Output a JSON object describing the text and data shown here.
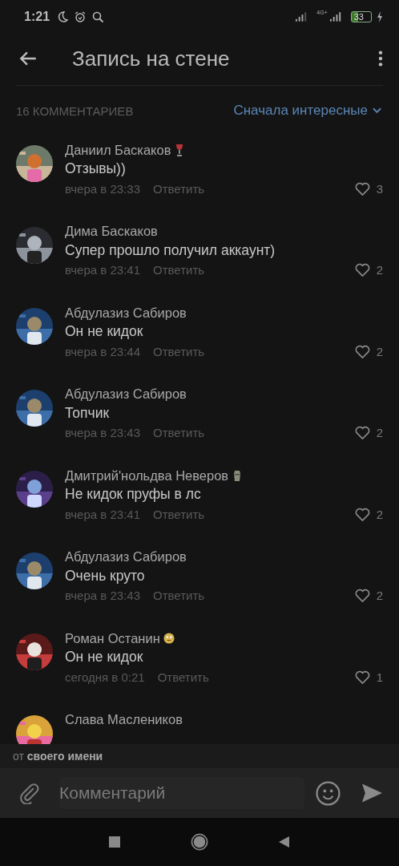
{
  "status_bar": {
    "time": "1:21",
    "network": "4G+",
    "battery": "33"
  },
  "header": {
    "title": "Запись на стене"
  },
  "comments_header": {
    "count": "16 КОММЕНТАРИЕВ",
    "sort": "Сначала интересные"
  },
  "comments": [
    {
      "author": "Даниил Баскаков",
      "badge": {
        "kind": "glass"
      },
      "text": "Отзывы))",
      "time": "вчера в 23:33",
      "reply": "Ответить",
      "likes": "3"
    },
    {
      "author": "Дима Баскаков",
      "text": "Супер прошло получил аккаунт)",
      "time": "вчера в 23:41",
      "reply": "Ответить",
      "likes": "2"
    },
    {
      "author": "Абдулазиз Сабиров",
      "text": "Он не кидок",
      "time": "вчера в 23:44",
      "reply": "Ответить",
      "likes": "2"
    },
    {
      "author": "Абдулазиз Сабиров",
      "text": "Топчик",
      "time": "вчера в 23:43",
      "reply": "Ответить",
      "likes": "2"
    },
    {
      "author": "Дмитрий'нольдва Неверов",
      "badge": {
        "kind": "statue"
      },
      "text": "Не кидок пруфы в лс",
      "time": "вчера в 23:41",
      "reply": "Ответить",
      "likes": "2"
    },
    {
      "author": "Абдулазиз Сабиров",
      "text": "Очень круто",
      "time": "вчера в 23:43",
      "reply": "Ответить",
      "likes": "2"
    },
    {
      "author": "Роман Останин",
      "badge": {
        "kind": "face"
      },
      "text": "Он не кидок",
      "time": "сегодня в 0:21",
      "reply": "Ответить",
      "likes": "1"
    },
    {
      "author": "Слава Маслеников"
    }
  ],
  "sender": {
    "prefix": "от",
    "name": "своего имени"
  },
  "composer": {
    "placeholder": "Комментарий"
  }
}
